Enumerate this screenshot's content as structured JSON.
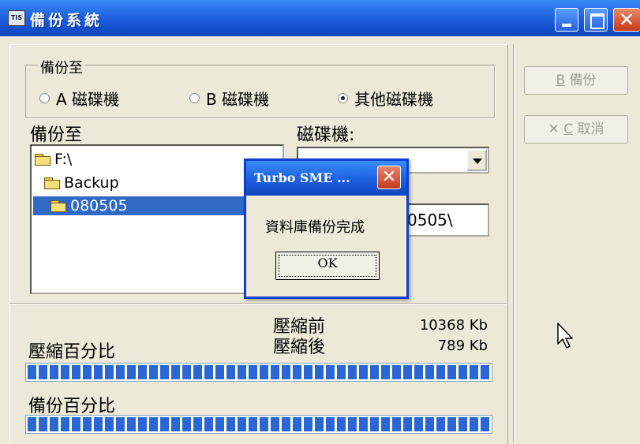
{
  "window": {
    "icon_text": "TIS",
    "title": "備份系統"
  },
  "destination_group": {
    "legend": "備份至",
    "options": [
      {
        "label": "A 磁碟機",
        "selected": false
      },
      {
        "label": "B 磁碟機",
        "selected": false
      },
      {
        "label": "其他磁碟機",
        "selected": true
      }
    ]
  },
  "folder_panel": {
    "label": "備份至",
    "tree": [
      "F:\\",
      "Backup",
      "080505"
    ],
    "selected": "080505"
  },
  "drive": {
    "label": "磁碟機:",
    "path_visible": "0505\\"
  },
  "compression": {
    "label": "壓縮百分比",
    "before_label": "壓縮前",
    "after_label": "壓縮後",
    "before_value": "10368 Kb",
    "after_value": "789 Kb",
    "progress": 1.0
  },
  "backup_progress": {
    "label": "備份百分比",
    "progress": 1.0
  },
  "buttons": {
    "backup": {
      "prefix": "B",
      "label": "備份"
    },
    "cancel": {
      "prefix": "C",
      "label": "取消"
    }
  },
  "dialog": {
    "title": "Turbo SME ...",
    "message": "資料庫備份完成",
    "ok": "OK",
    "close_glyph": "✕"
  },
  "colors": {
    "title_blue": "#1f63e0",
    "selection": "#316ac5",
    "progress_fill": "#2b66d6",
    "close_red": "#c8391a"
  }
}
